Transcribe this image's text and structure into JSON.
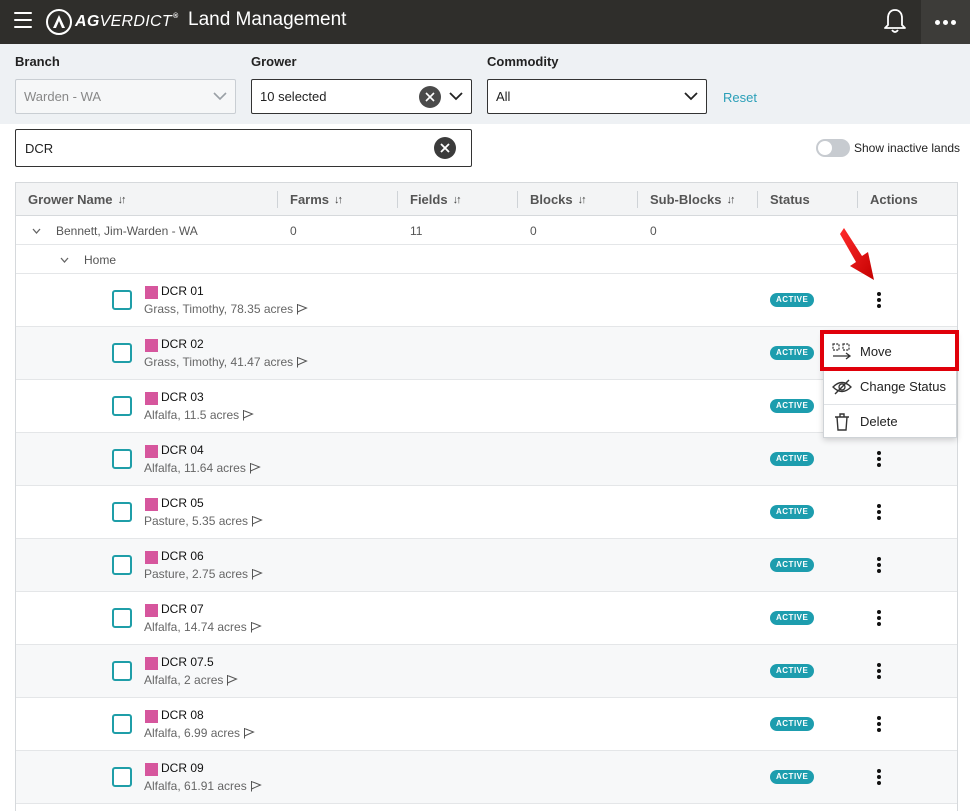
{
  "app": {
    "brand_bold": "AG",
    "brand_thin": "VERDICT",
    "brand_tm": "®",
    "title": "Land Management"
  },
  "filters": {
    "branch_label": "Branch",
    "branch_value": "Warden - WA",
    "grower_label": "Grower",
    "grower_value": "10 selected",
    "commodity_label": "Commodity",
    "commodity_value": "All",
    "reset_label": "Reset"
  },
  "search": {
    "value": "DCR"
  },
  "toggle": {
    "label": "Show inactive lands",
    "on": false
  },
  "table": {
    "headers": {
      "grower": "Grower Name",
      "farms": "Farms",
      "fields": "Fields",
      "blocks": "Blocks",
      "sub_blocks": "Sub-Blocks",
      "status": "Status",
      "actions": "Actions"
    },
    "sort_glyph": "↓↑",
    "grower_row": {
      "name": "Bennett, Jim-Warden - WA",
      "farms": "0",
      "fields": "11",
      "blocks": "0",
      "sub_blocks": "0"
    },
    "farm_row": {
      "name": "Home"
    },
    "fields": [
      {
        "name": "DCR 01",
        "desc": "Grass, Timothy, 78.35 acres",
        "status": "ACTIVE"
      },
      {
        "name": "DCR 02",
        "desc": "Grass, Timothy, 41.47 acres",
        "status": "ACTIVE"
      },
      {
        "name": "DCR 03",
        "desc": "Alfalfa, 11.5 acres",
        "status": "ACTIVE"
      },
      {
        "name": "DCR 04",
        "desc": "Alfalfa, 11.64 acres",
        "status": "ACTIVE"
      },
      {
        "name": "DCR 05",
        "desc": "Pasture, 5.35 acres",
        "status": "ACTIVE"
      },
      {
        "name": "DCR 06",
        "desc": "Pasture, 2.75 acres",
        "status": "ACTIVE"
      },
      {
        "name": "DCR 07",
        "desc": "Alfalfa, 14.74 acres",
        "status": "ACTIVE"
      },
      {
        "name": "DCR 07.5",
        "desc": "Alfalfa, 2 acres",
        "status": "ACTIVE"
      },
      {
        "name": "DCR 08",
        "desc": "Alfalfa, 6.99 acres",
        "status": "ACTIVE"
      },
      {
        "name": "DCR 09",
        "desc": "Alfalfa, 61.91 acres",
        "status": "ACTIVE"
      }
    ]
  },
  "menu": {
    "items": [
      {
        "label": "Move",
        "icon": "move-icon"
      },
      {
        "label": "Change Status",
        "icon": "eye-slash-icon"
      },
      {
        "label": "Delete",
        "icon": "trash-icon"
      }
    ]
  },
  "colors": {
    "topbar": "#2f2e2b",
    "accent": "#1d9dae",
    "swatch": "#d6569d",
    "highlight": "#e0000a"
  }
}
